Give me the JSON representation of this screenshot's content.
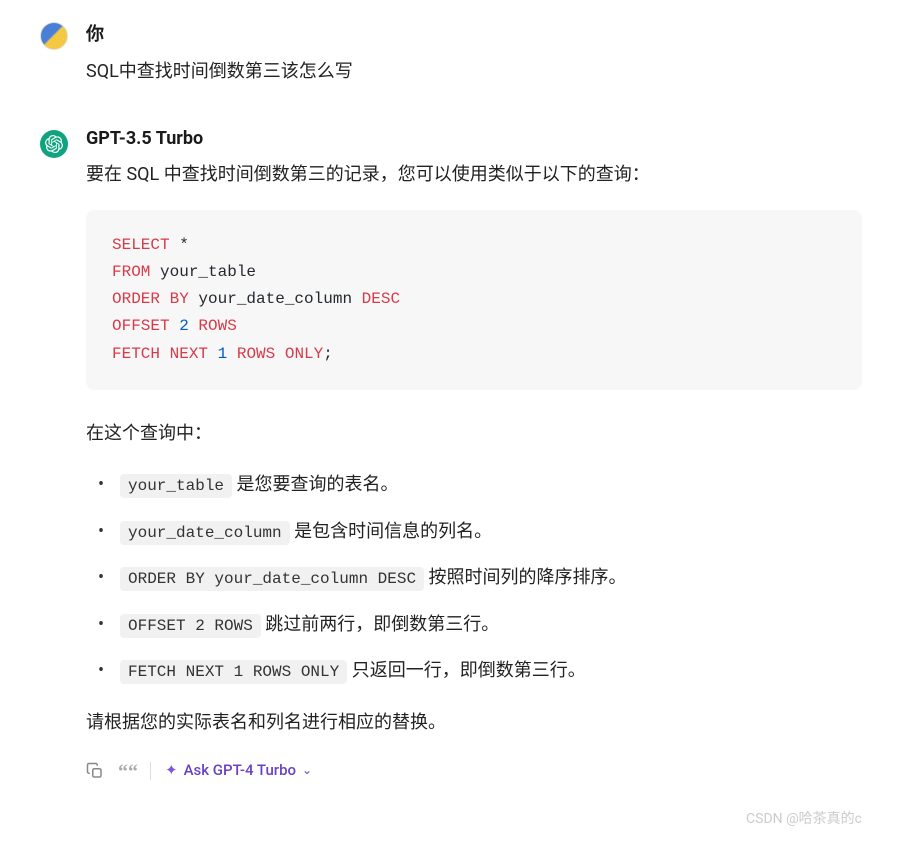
{
  "user": {
    "name": "你",
    "message": "SQL中查找时间倒数第三该怎么写"
  },
  "bot": {
    "name": "GPT-3.5 Turbo",
    "intro": "要在 SQL 中查找时间倒数第三的记录，您可以使用类似于以下的查询：",
    "explain_header": "在这个查询中：",
    "bullets": [
      {
        "code": "your_table",
        "text": " 是您要查询的表名。"
      },
      {
        "code": "your_date_column",
        "text": " 是包含时间信息的列名。"
      },
      {
        "code": "ORDER BY your_date_column DESC",
        "text": " 按照时间列的降序排序。"
      },
      {
        "code": "OFFSET 2 ROWS",
        "text": " 跳过前两行，即倒数第三行。"
      },
      {
        "code": "FETCH NEXT 1 ROWS ONLY",
        "text": " 只返回一行，即倒数第三行。"
      }
    ],
    "outro": "请根据您的实际表名和列名进行相应的替换。",
    "code": {
      "select": "SELECT",
      "star": " *",
      "from": "FROM",
      "tbl": " your_table",
      "order": "ORDER BY",
      "col": " your_date_column ",
      "desc": "DESC",
      "offset": "OFFSET",
      "two": " 2",
      "rows1": " ROWS",
      "fetch": "FETCH",
      "next": " NEXT",
      "one": " 1",
      "rows2": " ROWS",
      "only": " ONLY",
      "semi": ";"
    }
  },
  "actions": {
    "ask_label": "Ask GPT-4 Turbo"
  },
  "watermark": "CSDN @哈茶真的c"
}
